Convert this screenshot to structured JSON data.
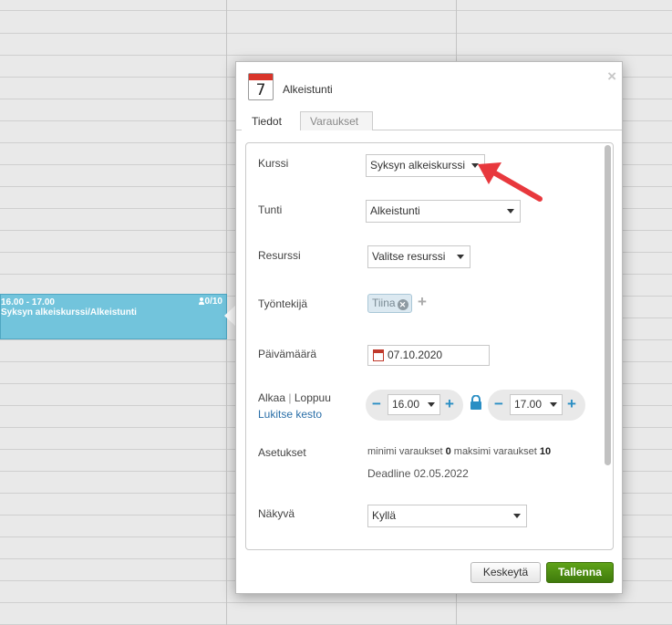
{
  "calendar": {
    "event": {
      "time": "16.00 - 17.00",
      "title": "Syksyn alkeiskurssi/Alkeistunti",
      "count": "0/10"
    }
  },
  "dialog": {
    "icon_number": "7",
    "title": "Alkeistunti",
    "close": "×",
    "tabs": [
      {
        "label": "Tiedot",
        "active": true
      },
      {
        "label": "Varaukset",
        "active": false
      }
    ],
    "form": {
      "kurssi": {
        "label": "Kurssi",
        "value": "Syksyn alkeiskurssi"
      },
      "tunti": {
        "label": "Tunti",
        "value": "Alkeistunti"
      },
      "resurssi": {
        "label": "Resurssi",
        "value": "Valitse resurssi"
      },
      "tyontekija": {
        "label": "Työntekijä",
        "chip": "Tiina",
        "add": "+"
      },
      "paivamaara": {
        "label": "Päivämäärä",
        "value": "07.10.2020"
      },
      "aika": {
        "label_start": "Alkaa",
        "separator": "|",
        "label_end": "Loppuu",
        "lock_link": "Lukitse kesto",
        "start": "16.00",
        "end": "17.00",
        "minus": "−",
        "plus": "+"
      },
      "asetukset": {
        "label": "Asetukset",
        "min_label": "minimi varaukset",
        "min_value": "0",
        "max_label": "maksimi varaukset",
        "max_value": "10",
        "deadline": "Deadline 02.05.2022"
      },
      "nakyva": {
        "label": "Näkyvä",
        "value": "Kyllä"
      }
    },
    "buttons": {
      "cancel": "Keskeytä",
      "save": "Tallenna"
    }
  },
  "colors": {
    "event_bg": "#72c4dc",
    "save_button": "#4f8f12",
    "link": "#2a6fa8",
    "stepper": "#2a8ec4",
    "annotation_arrow": "#e8383d"
  }
}
